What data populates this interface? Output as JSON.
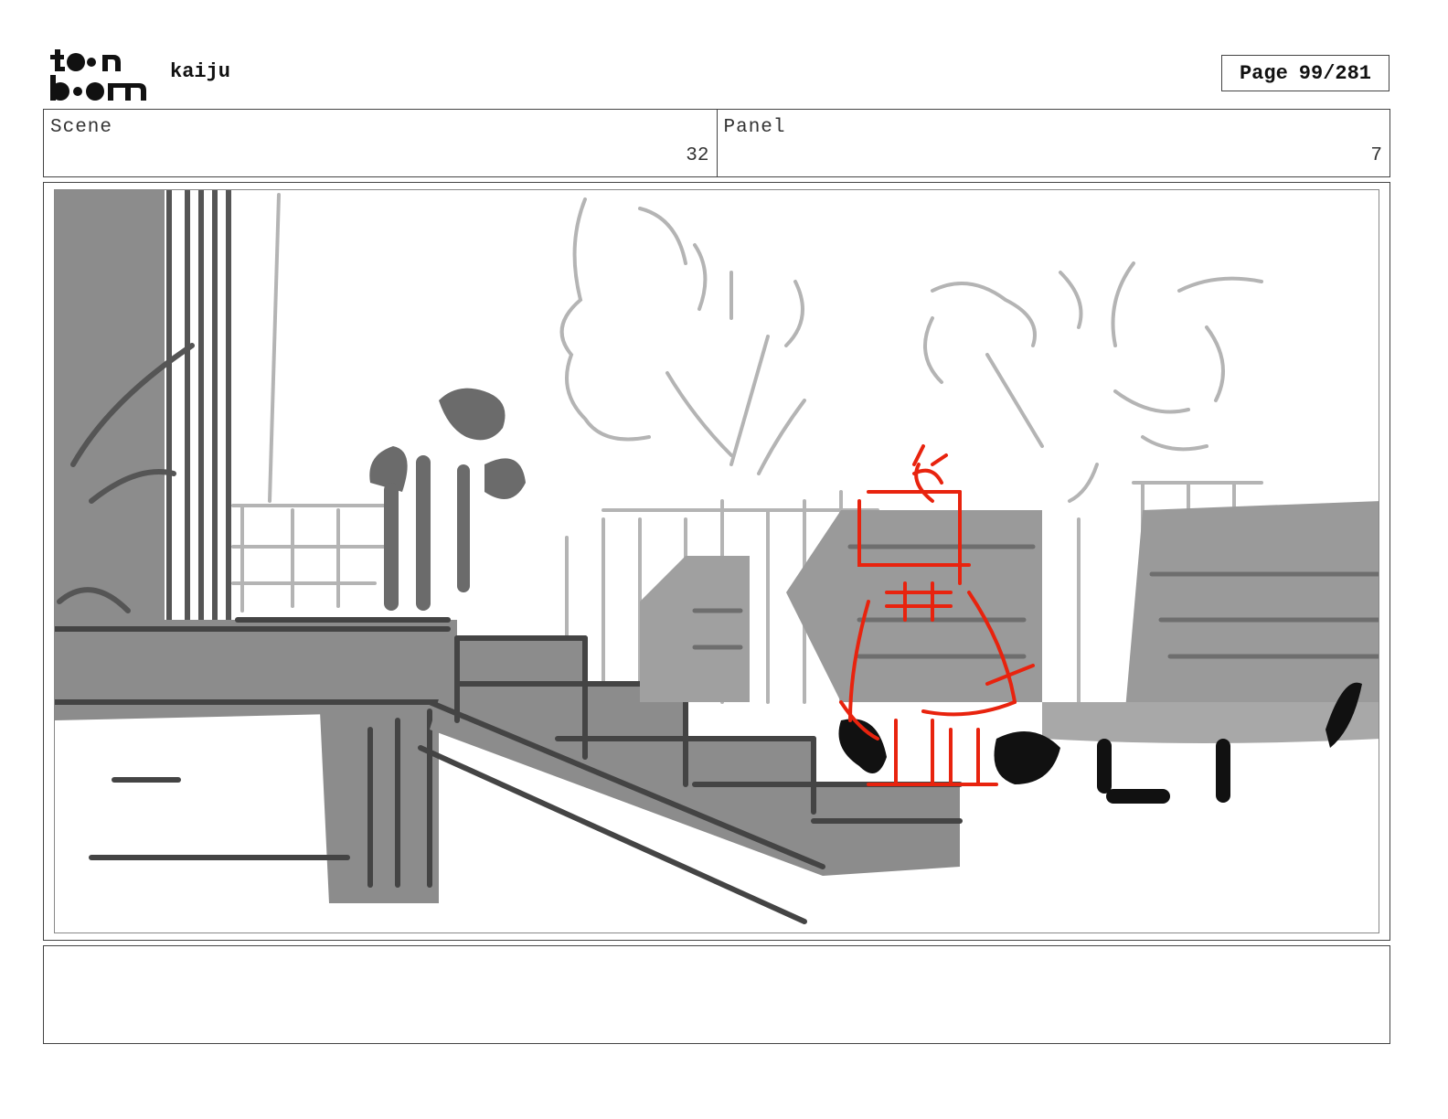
{
  "header": {
    "project_title": "kaiju",
    "page_label": "Page",
    "page_value": "99/281"
  },
  "scene": {
    "label": "Scene",
    "value": "32"
  },
  "panel": {
    "label": "Panel",
    "value": "7"
  },
  "notes": {
    "text": ""
  },
  "colors": {
    "ink": "#111111",
    "dark_gray": "#555555",
    "mid_gray": "#8c8c8c",
    "light_gray": "#b4b4b4",
    "red_sketch": "#e8230e"
  },
  "icons": {
    "logo": "toonboom-logo"
  }
}
